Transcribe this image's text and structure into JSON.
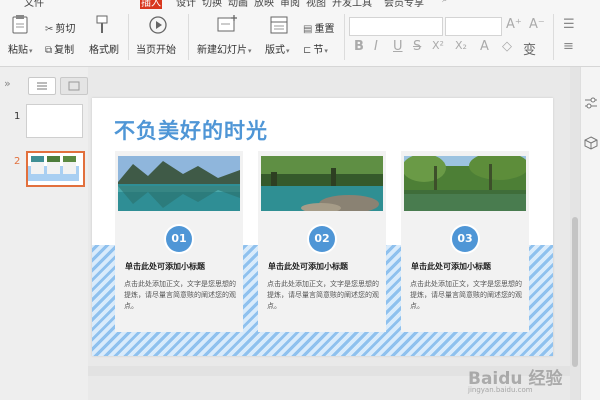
{
  "menu": {
    "items": [
      "文件",
      "开始",
      "插入",
      "设计",
      "切换",
      "动画",
      "放映",
      "审阅",
      "视图",
      "开发工具",
      "会员专享"
    ],
    "active_index": 1
  },
  "ribbon": {
    "paste_label": "粘贴",
    "cut_label": "剪切",
    "copy_label": "复制",
    "format_painter_label": "格式刷",
    "play_from_current_label": "当页开始",
    "new_slide_label": "新建幻灯片",
    "layout_label": "版式",
    "reset_label": "重置",
    "section_label": "节",
    "font_buttons": [
      "B",
      "I",
      "U",
      "S",
      "X²",
      "X₂",
      "A",
      "⌫",
      "变"
    ],
    "grow_font": "A⁺",
    "shrink_font": "A⁻",
    "clear_format": "◇"
  },
  "slides_panel": {
    "thumbnails": [
      {
        "number": "1"
      },
      {
        "number": "2"
      }
    ],
    "selected_index": 1
  },
  "slide": {
    "title": "不负美好的时光",
    "cards": [
      {
        "number": "01",
        "subtitle": "单击此处可添加小标题",
        "body": "点击此处添加正文，文字是您思想的提炼，请尽量言简意赅的阐述您的观点。",
        "scene": "lake"
      },
      {
        "number": "02",
        "subtitle": "单击此处可添加小标题",
        "body": "点击此处添加正文，文字是您思想的提炼，请尽量言简意赅的阐述您的观点。",
        "scene": "rocks"
      },
      {
        "number": "03",
        "subtitle": "单击此处可添加小标题",
        "body": "点击此处添加正文，文字是您思想的提炼，请尽量言简意赅的阐述您的观点。",
        "scene": "forest"
      }
    ]
  },
  "colors": {
    "accent": "#4f96d6",
    "menu_highlight": "#d8371e",
    "selected_thumb": "#e2703d"
  },
  "watermark": {
    "text": "Baidu 经验",
    "subtext": "jingyan.baidu.com"
  }
}
